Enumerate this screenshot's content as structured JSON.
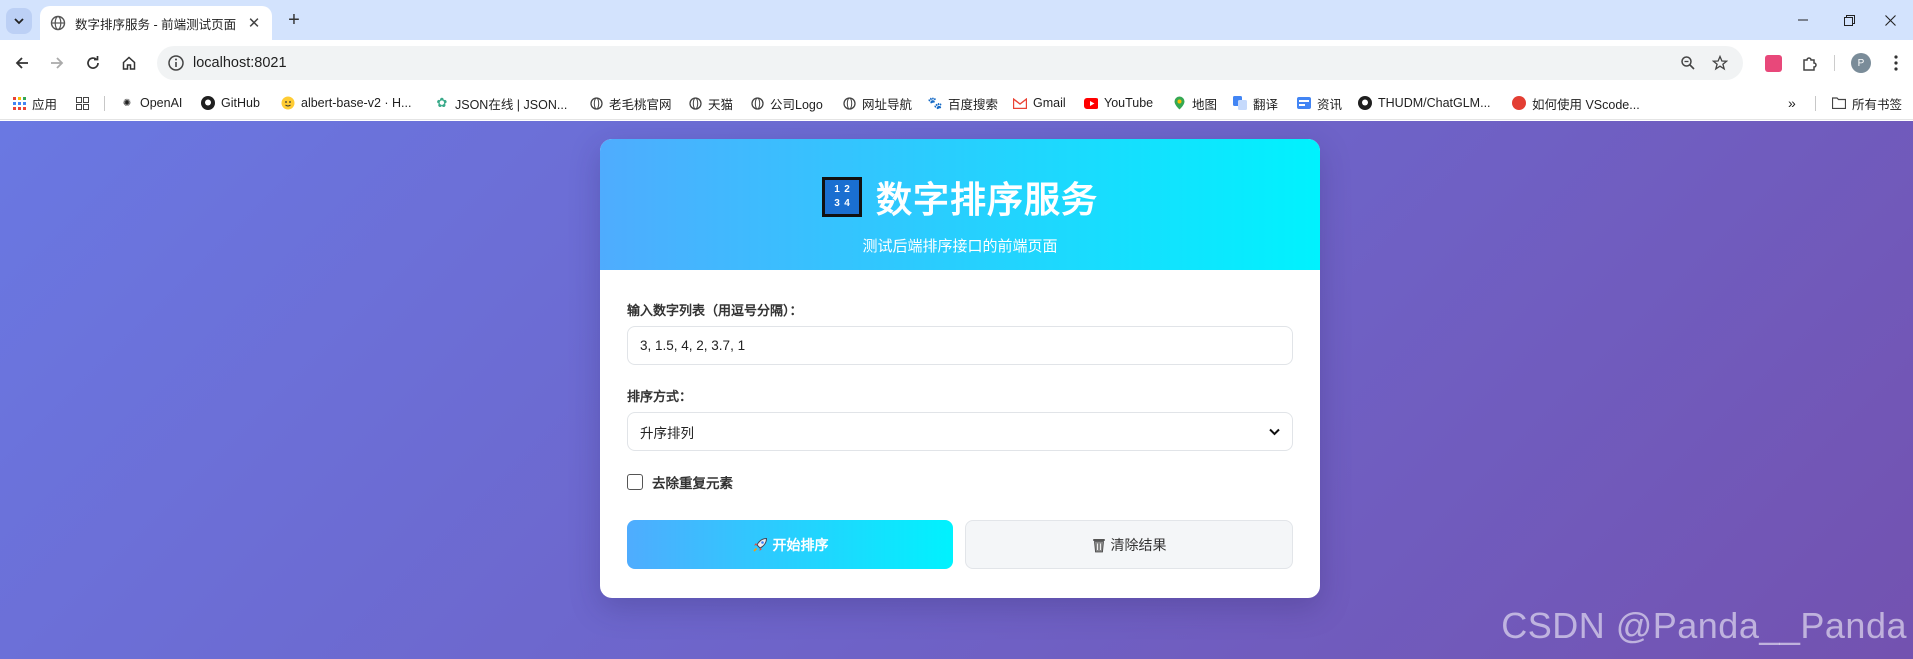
{
  "browser": {
    "tab": {
      "title": "数字排序服务 - 前端测试页面"
    },
    "address": {
      "url": "localhost:8021"
    },
    "profile": {
      "initial": "P"
    },
    "bookmarks": [
      {
        "label": "应用",
        "icon": "apps-grid-icon"
      },
      {
        "label": "",
        "icon": "grid-icon"
      },
      {
        "label": "OpenAI",
        "icon": "openai-icon"
      },
      {
        "label": "GitHub",
        "icon": "github-icon"
      },
      {
        "label": "albert-base-v2 · H...",
        "icon": "huggingface-icon"
      },
      {
        "label": "JSON在线 | JSON...",
        "icon": "json-icon"
      },
      {
        "label": "老毛桃官网",
        "icon": "globe-icon"
      },
      {
        "label": "天猫",
        "icon": "globe-icon"
      },
      {
        "label": "公司Logo",
        "icon": "globe-icon"
      },
      {
        "label": "网址导航",
        "icon": "globe-icon"
      },
      {
        "label": "百度搜索",
        "icon": "baidu-icon"
      },
      {
        "label": "Gmail",
        "icon": "gmail-icon"
      },
      {
        "label": "YouTube",
        "icon": "youtube-icon"
      },
      {
        "label": "地图",
        "icon": "maps-icon"
      },
      {
        "label": "翻译",
        "icon": "translate-icon"
      },
      {
        "label": "资讯",
        "icon": "news-icon"
      },
      {
        "label": "THUDM/ChatGLM...",
        "icon": "github-icon"
      },
      {
        "label": "如何使用 VScode...",
        "icon": "csdn-icon"
      }
    ],
    "all_bookmarks": "所有书签"
  },
  "page": {
    "header": {
      "icon_digits": [
        "1",
        "2",
        "3",
        "4"
      ],
      "title": "数字排序服务",
      "subtitle": "测试后端排序接口的前端页面"
    },
    "form": {
      "numbers_label": "输入数字列表（用逗号分隔）：",
      "numbers_value": "3, 1.5, 4, 2, 3.7, 1",
      "sort_label": "排序方式：",
      "sort_selected": "升序排列",
      "dedupe_label": "去除重复元素",
      "dedupe_checked": false,
      "sort_button": "开始排序",
      "clear_button": "清除结果"
    }
  },
  "watermark": "CSDN @Panda__Panda",
  "colors": {
    "header_gradient_start": "#4facfe",
    "header_gradient_end": "#00f2fe",
    "background_start": "#6a78e2",
    "background_end": "#7352b0"
  }
}
